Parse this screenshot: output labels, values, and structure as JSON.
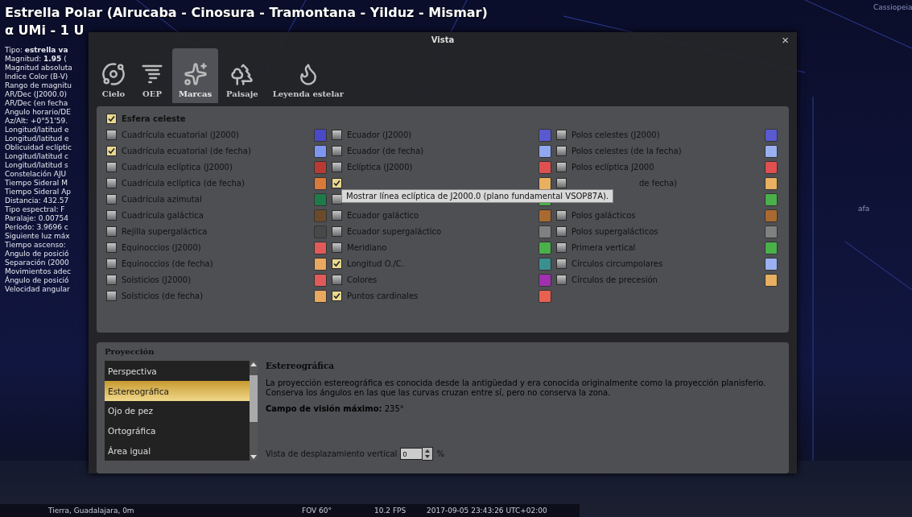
{
  "object_title": [
    "Estrella Polar (Alrucaba - Cinosura - Tramontana - Yilduz - Mismar)",
    "α UMi - 1 U"
  ],
  "object_info": [
    "Tipo: **estrella va**",
    "Magnitud: **1.95** (",
    "Magnitud absoluta",
    "Indice Color (B-V)",
    "Rango de magnitu",
    "AR/Dec (J2000.0)",
    "AR/Dec (en fecha",
    "Angulo horario/DE",
    "Az/Alt: +0°51'59.",
    "Longitud/latitud e",
    "Longitud/latitud e",
    "Oblicuidad eclíptic",
    "Longitud/latitud c",
    "Longitud/latitud s",
    "Constelación AJU",
    "Tiempo Sideral M",
    "Tiempo Sideral Ap",
    "Distancia: 432.57",
    "Tipo espectral: F",
    "Paralaje: 0.00754",
    "Período: 3.9696 c",
    "Siguiente luz máx",
    "Tiempo ascenso:",
    "Angulo de posició",
    "Separación (2000",
    "Movimientos adec",
    "Ángulo de posició",
    "Velocidad angular"
  ],
  "sky_labels": [
    "Cassiopeia",
    "afa"
  ],
  "dialog": {
    "title": "Vista",
    "close": "×",
    "tabs": [
      {
        "label": "Cielo",
        "selected": false
      },
      {
        "label": "OEP",
        "selected": false
      },
      {
        "label": "Marcas",
        "selected": true
      },
      {
        "label": "Paisaje",
        "selected": false
      },
      {
        "label": "Leyenda estelar",
        "selected": false
      }
    ],
    "celestial_sphere": {
      "label": "Esfera celeste",
      "checked": true
    },
    "grids": [
      {
        "label": "Cuadrícula ecuatorial (J2000)",
        "checked": false
      },
      {
        "label": "Cuadrícula ecuatorial (de fecha)",
        "checked": true
      },
      {
        "label": "Cuadrícula eclíptica (J2000)",
        "checked": false
      },
      {
        "label": "Cuadrícula eclíptica (de fecha)",
        "checked": false
      },
      {
        "label": "Cuadrícula azimutal",
        "checked": false
      },
      {
        "label": "Cuadrícula galáctica",
        "checked": false
      },
      {
        "label": "Rejilla supergaláctica",
        "checked": false
      },
      {
        "label": "Equinoccios (J2000)",
        "checked": false
      },
      {
        "label": "Equinoccios (de fecha)",
        "checked": false
      },
      {
        "label": "Solsticios (J2000)",
        "checked": false
      },
      {
        "label": "Solsticios (de fecha)",
        "checked": false
      }
    ],
    "lines": [
      {
        "label": "Ecuador (J2000)",
        "checked": false,
        "color": "#4a4ac8"
      },
      {
        "label": "Ecuador (de fecha)",
        "checked": false,
        "color": "#7f96f0"
      },
      {
        "label": "Eclíptica (J2000)",
        "checked": false,
        "color": "#b83a32"
      },
      {
        "checked": true,
        "color": "#d87a3a",
        "tooltip": "Mostrar línea eclíptica de J2000.0 (plano fundamental VSOP87A)."
      },
      {
        "checked": false,
        "color": "#1f7a4a"
      },
      {
        "label": "Ecuador galáctico",
        "checked": false,
        "color": "#6a4a2a"
      },
      {
        "label": "Ecuador supergaláctico",
        "checked": false,
        "color": "#484848"
      },
      {
        "label": "Meridiano",
        "checked": false,
        "color": "#e05a5a"
      },
      {
        "label": "Longitud O./C.",
        "checked": true,
        "color": "#e8a860"
      },
      {
        "label": "Colores",
        "checked": false,
        "color": "#e05a5a"
      },
      {
        "label": "Puntos cardinales",
        "checked": true,
        "color": "#e8a860"
      }
    ],
    "points": [
      {
        "kind": "row",
        "label": "Polos celestes (J2000)",
        "checked": false,
        "color": "#5a5ad0",
        "end_swatch": {
          "color": "#5a5ad0"
        }
      },
      {
        "kind": "row",
        "label": "Polos celestes (de la fecha)",
        "checked": false,
        "color": "#8fa8f0",
        "end_swatch": {
          "color": "#9ab0f0"
        }
      },
      {
        "kind": "row",
        "label": "Polos eclíptica J2000",
        "checked": false,
        "color": "#e05050",
        "end_swatch": {
          "color": "#e05050"
        }
      },
      {
        "kind": "row",
        "label": "de fecha)",
        "checked": false,
        "color": "#e8b060",
        "end_swatch": {
          "color": "#e8b060"
        }
      },
      {
        "kind": "row",
        "color": "#4ab04a",
        "end_swatch": {
          "color": "#4ab04a"
        }
      },
      {
        "kind": "row",
        "label": "Polos galácticos",
        "checked": false,
        "color": "#a86a30",
        "end_swatch": {
          "color": "#a86a30"
        }
      },
      {
        "kind": "row",
        "label": "Polos supergalácticos",
        "checked": false,
        "color": "#808080",
        "end_swatch": {
          "color": "#808080"
        }
      },
      {
        "kind": "row",
        "label": "Primera vertical",
        "checked": false,
        "color": "#4ab04a",
        "end_swatch": {
          "color": "#4ab04a"
        }
      },
      {
        "kind": "row",
        "label": "Círculos circumpolares",
        "checked": false,
        "color": "#3a9090",
        "end_swatch": {
          "color": "#9ab0f0"
        }
      },
      {
        "kind": "row",
        "label": "Círculos de precesión",
        "checked": false,
        "color": "#a030b0",
        "end_swatch": {
          "color": "#e8b060"
        }
      },
      {
        "kind": "swatch",
        "color": "#e86050"
      }
    ],
    "projection": {
      "heading": "Proyección",
      "items": [
        {
          "label": "Perspectiva",
          "selected": false
        },
        {
          "label": "Estereográfica",
          "selected": true
        },
        {
          "label": "Ojo de pez",
          "selected": false
        },
        {
          "label": "Ortográfica",
          "selected": false
        },
        {
          "label": "Área igual",
          "selected": false
        }
      ],
      "title": "Estereográfica",
      "description": "La proyección estereográfica es conocida desde la antigüedad y era conocida originalmente como la proyección planisferio. Conserva los ángulos en las que las curvas cruzan entre sí, pero no conserva la zona.",
      "max_fov": "**Campo de visión máximo:** 235°",
      "shift_label": "Vista de desplazamiento vertical",
      "shift_value": "0",
      "shift_unit": "%"
    }
  },
  "status_bar": {
    "location": "Tierra, Guadalajara, 0m",
    "fov": "FOV 60°",
    "fps": "10.2 FPS",
    "datetime": "2017-09-05 23:43:26 UTC+02:00"
  }
}
